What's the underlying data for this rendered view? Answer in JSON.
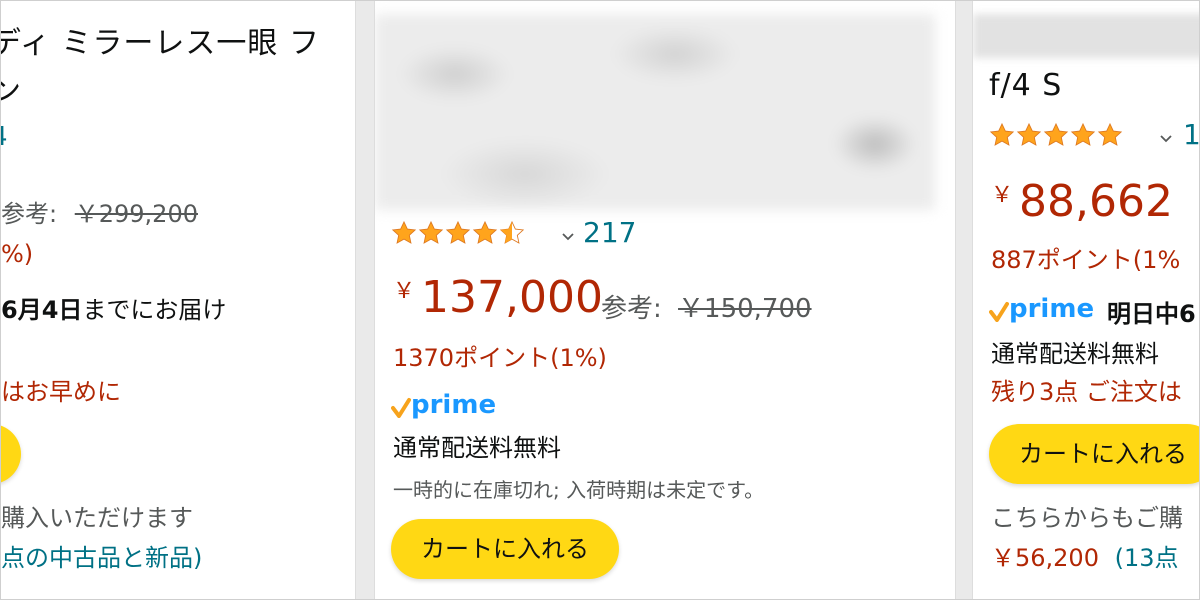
{
  "left_card": {
    "title_line1": "ディ ミラーレス一眼 フ",
    "title_line2": "ン",
    "rating_count": "4",
    "ref_label": "参考:",
    "ref_price": "￥299,200",
    "points": "%)",
    "delivery_bold": "6月4日",
    "delivery_rest": "までにお届け",
    "stock_note": "はお早めに",
    "other_buy": "購入いただけます",
    "other_offers": "点の中古品と新品)"
  },
  "middle_card": {
    "rating_count": "217",
    "price_symbol": "￥",
    "price": "137,000",
    "ref_label": "参考:",
    "ref_price": "￥150,700",
    "points": "1370ポイント(1%)",
    "prime": "prime",
    "shipping": "通常配送料無料",
    "stock_status": "一時的に在庫切れ; 入荷時期は未定です。",
    "cart_button": "カートに入れる"
  },
  "right_card": {
    "title": "f/4 S",
    "rating_count": "1",
    "price_symbol": "￥",
    "price": "88,662",
    "points": "887ポイント(1%",
    "prime": "prime",
    "delivery": "明日中6",
    "shipping": "通常配送料無料",
    "stock_note": "残り3点 ご注文は",
    "cart_button": "カートに入れる",
    "other_buy": "こちらからもご購",
    "other_price": "￥56,200",
    "other_offers": "(13点"
  },
  "colors": {
    "accent_red": "#b12704",
    "link_teal": "#007185",
    "star_orange": "#ffa41c",
    "button_yellow": "#ffd814",
    "prime_blue": "#1a98ff"
  },
  "icons": {
    "star": "star-icon",
    "chevron": "chevron-down-icon",
    "prime_check": "prime-check-icon"
  }
}
